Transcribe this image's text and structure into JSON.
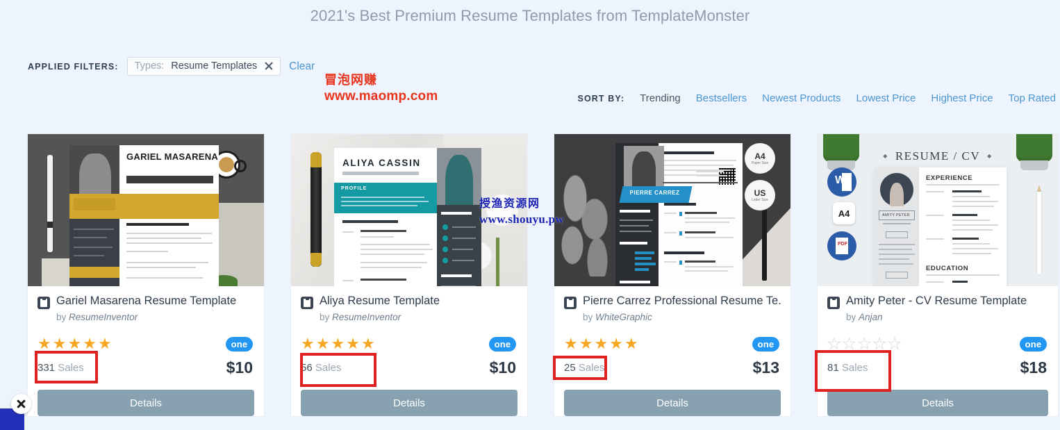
{
  "page": {
    "title": "2021's Best Premium Resume Templates from TemplateMonster",
    "background_color": "#eef4fd"
  },
  "filters": {
    "label": "APPLIED FILTERS:",
    "chip": {
      "prefix": "Types:",
      "value": "Resume Templates",
      "remove_icon": "close-icon"
    },
    "clear_label": "Clear"
  },
  "watermarks": {
    "red": {
      "line1": "冒泡网赚",
      "line2": "www.maomp.com",
      "color": "#e8341c"
    },
    "blue": {
      "line1": "授渔资源网",
      "line2": "www.shouyu.pw",
      "color": "#1a23b4"
    }
  },
  "sort": {
    "label": "SORT BY:",
    "options": [
      {
        "label": "Trending",
        "active": true
      },
      {
        "label": "Bestsellers",
        "active": false
      },
      {
        "label": "Newest Products",
        "active": false
      },
      {
        "label": "Lowest Price",
        "active": false
      },
      {
        "label": "Highest Price",
        "active": false
      },
      {
        "label": "Top Rated",
        "active": false
      }
    ]
  },
  "products": [
    {
      "title": "Gariel Masarena Resume Template",
      "by_label": "by",
      "author": "ResumeInventor",
      "rating": 5,
      "sales_count": "331",
      "sales_label": "Sales",
      "price": "$10",
      "badge": "one",
      "details_label": "Details",
      "thumb_name": "GARIEL MASARENA"
    },
    {
      "title": "Aliya Resume Template",
      "by_label": "by",
      "author": "ResumeInventor",
      "rating": 5,
      "sales_count": "56",
      "sales_label": "Sales",
      "price": "$10",
      "badge": "one",
      "details_label": "Details",
      "thumb_name": "ALIYA CASSIN"
    },
    {
      "title": "Pierre Carrez Professional Resume Te...",
      "by_label": "by",
      "author": "WhiteGraphic",
      "rating": 5,
      "sales_count": "25",
      "sales_label": "Sales",
      "price": "$13",
      "badge": "one",
      "details_label": "Details",
      "thumb_name": "PIERRE CARREZ",
      "thumb_badges": [
        {
          "main": "A4",
          "sub": "Paper Size"
        },
        {
          "main": "US",
          "sub": "Letter Size"
        }
      ]
    },
    {
      "title": "Amity Peter - CV Resume Template",
      "by_label": "by",
      "author": "Anjan",
      "rating": 0,
      "sales_count": "81",
      "sales_label": "Sales",
      "price": "$18",
      "badge": "one",
      "details_label": "Details",
      "thumb_name": "AMITY PETER",
      "thumb_heading": "RESUME / CV",
      "thumb_sections": [
        "EXPERIENCE",
        "EDUCATION"
      ],
      "thumb_badges": [
        "W",
        "A4",
        "PDF"
      ]
    }
  ],
  "annotations": {
    "color": "#e02121",
    "note": "red rectangles highlighting the Sales counts"
  },
  "overlay": {
    "close_icon": "close-icon"
  },
  "colors": {
    "star_filled": "#f5a623",
    "badge_blue": "#2196f3",
    "link_blue": "#4a97d2",
    "details_button": "#87a1b0"
  }
}
